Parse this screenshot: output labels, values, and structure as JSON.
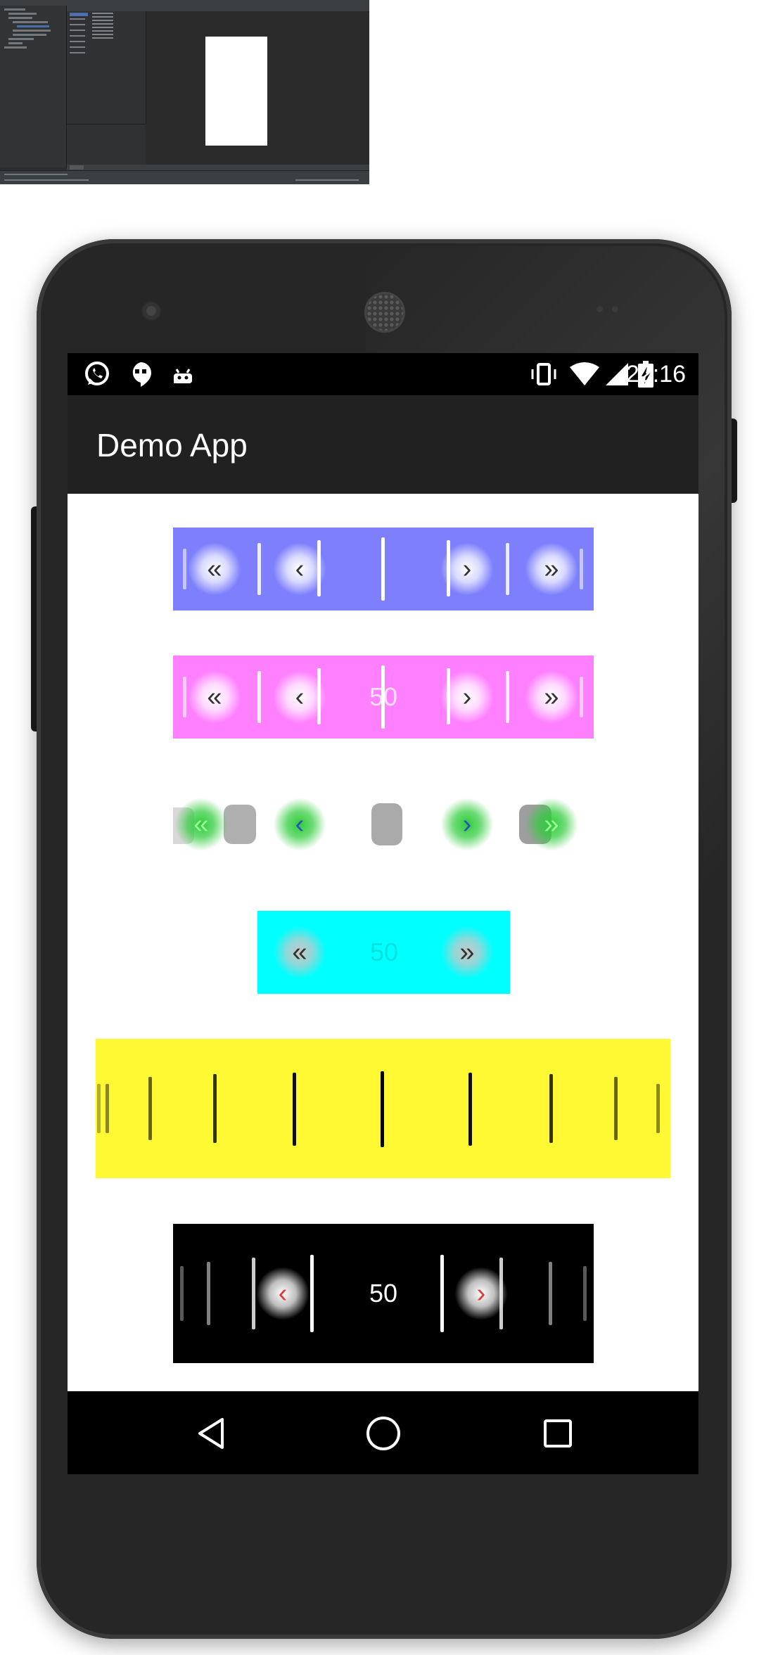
{
  "status_bar": {
    "time": "22:16",
    "left_icons": [
      "whatsapp-icon",
      "hangouts-icon",
      "android-icon"
    ],
    "right_icons": [
      "vibrate-icon",
      "wifi-icon",
      "signal-icon",
      "battery-charging-icon"
    ]
  },
  "app": {
    "title": "Demo App"
  },
  "pickers": [
    {
      "name": "blue-picker",
      "background": "#7d7ffc",
      "value": "",
      "controls": [
        "«",
        "‹",
        "›",
        "»"
      ]
    },
    {
      "name": "pink-picker",
      "background": "#ff80ff",
      "value": "50",
      "controls": [
        "«",
        "‹",
        "›",
        "»"
      ]
    },
    {
      "name": "green-button-picker",
      "background": "#ffffff",
      "value": "",
      "controls": [
        "«",
        "‹",
        "›",
        "»"
      ],
      "accent": "#22c22c"
    },
    {
      "name": "cyan-picker",
      "background": "#00ffff",
      "value": "50",
      "controls": [
        "«",
        "»"
      ]
    },
    {
      "name": "yellow-picker",
      "background": "#fff933",
      "value": "",
      "controls": []
    },
    {
      "name": "black-picker",
      "background": "#000000",
      "value": "50",
      "controls": [
        "‹",
        "›"
      ],
      "accent": "#e53935"
    }
  ],
  "navigation": {
    "icons": [
      "back-icon",
      "home-icon",
      "recents-icon"
    ]
  },
  "ide": {
    "canvas_device_color": "#ffffff",
    "theme": "#2b2d30"
  }
}
